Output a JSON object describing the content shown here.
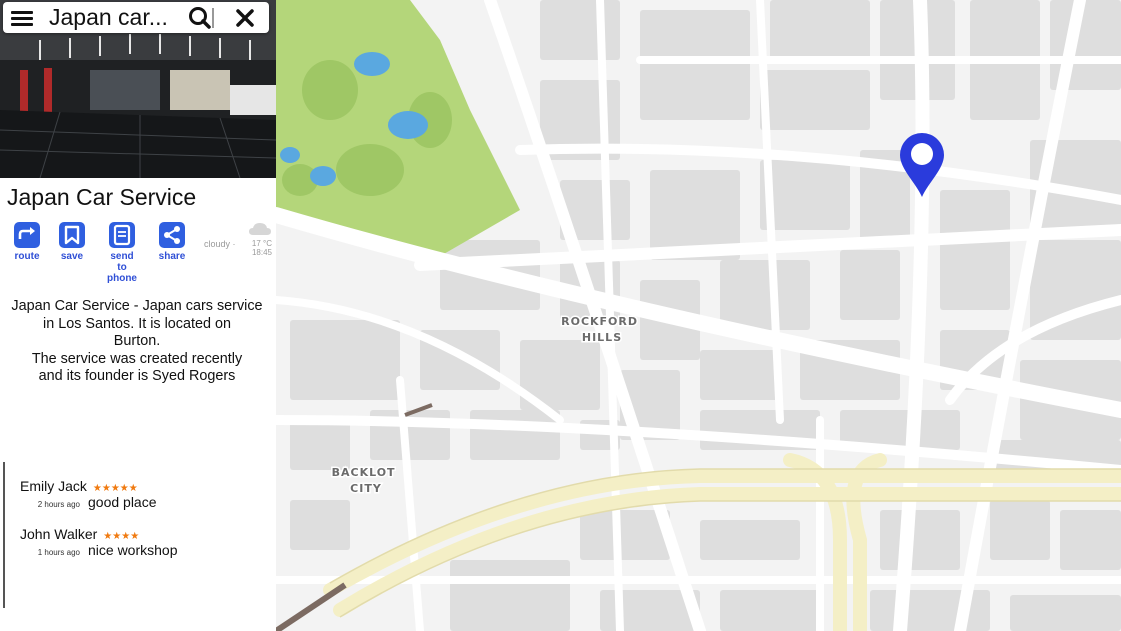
{
  "search": {
    "value": "Japan car..."
  },
  "place": {
    "title": "Japan Car Service"
  },
  "actions": [
    {
      "label_lines": [
        "route"
      ],
      "icon": "route-icon"
    },
    {
      "label_lines": [
        "save"
      ],
      "icon": "bookmark-icon"
    },
    {
      "label_lines": [
        "send",
        "to phone"
      ],
      "icon": "phone-icon"
    },
    {
      "label_lines": [
        "share"
      ],
      "icon": "share-icon"
    }
  ],
  "weather": {
    "condition": "cloudy ·",
    "temperature": "17 °C",
    "time": "18:45",
    "icon": "cloud-icon"
  },
  "description": [
    "Japan Car Service - Japan cars service",
    "in Los Santos. It is located on",
    "Burton.",
    "The service was created recently",
    "and its founder is Syed Rogers"
  ],
  "reviews": [
    {
      "author": "Emily Jack",
      "rating": 5,
      "stars": "★★★★★",
      "time_ago": "2 hours ago",
      "text": "good place"
    },
    {
      "author": "John Walker",
      "rating": 4,
      "stars": "★★★★",
      "time_ago": "1 hours ago",
      "text": "nice workshop"
    }
  ],
  "map": {
    "labels": [
      {
        "lines": [
          "ROCKFORD",
          "HILLS"
        ]
      },
      {
        "lines": [
          "BACKLOT",
          "CITY"
        ]
      }
    ],
    "marker_icon": "map-pin-icon",
    "colors": {
      "marker": "#2a3bdc",
      "park": "#b4d67a",
      "water": "#5aa8e0",
      "freeway": "#f4efc6",
      "block": "#dedede",
      "road": "#ffffff"
    }
  }
}
